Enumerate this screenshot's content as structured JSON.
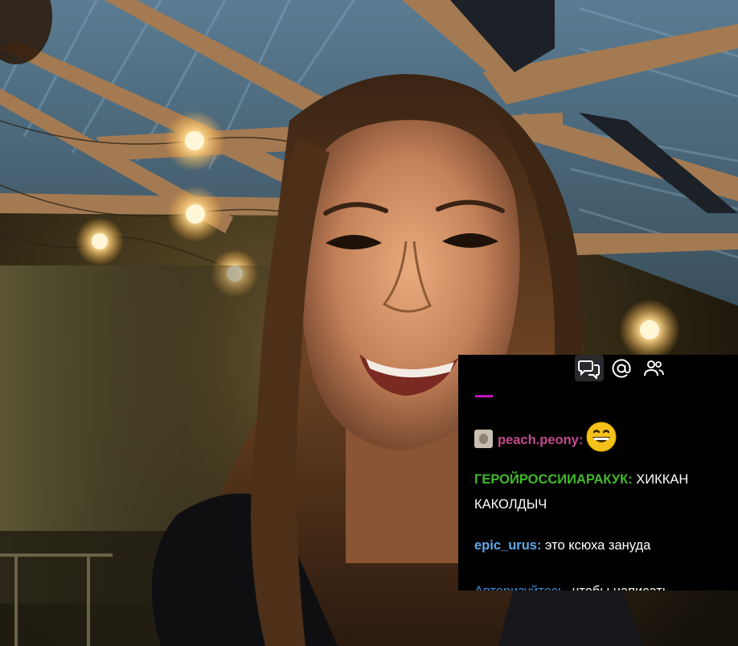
{
  "stream": {
    "scene": "live-video"
  },
  "chat": {
    "tabs": [
      {
        "icon": "chat-bubbles-icon",
        "active": true
      },
      {
        "icon": "at-mention-icon",
        "active": false
      },
      {
        "icon": "people-icon",
        "active": false
      }
    ],
    "messages": [
      {
        "user": "peach.peony:",
        "text": "",
        "emoji": "grinning-face-emoji",
        "color": "#c34a8c"
      },
      {
        "user": "ГЕРОЙРОССИИАРАКУК:",
        "text": " ХИККАН КАКОЛДЫЧ",
        "color": "#41b82a"
      },
      {
        "user": "epic_urus:",
        "text": " это ксюха зануда",
        "color": "#5fa9e9"
      },
      {
        "user": "Авторизуйтесь",
        "text": ", чтобы написать",
        "color": "#3b8dd8"
      }
    ]
  }
}
